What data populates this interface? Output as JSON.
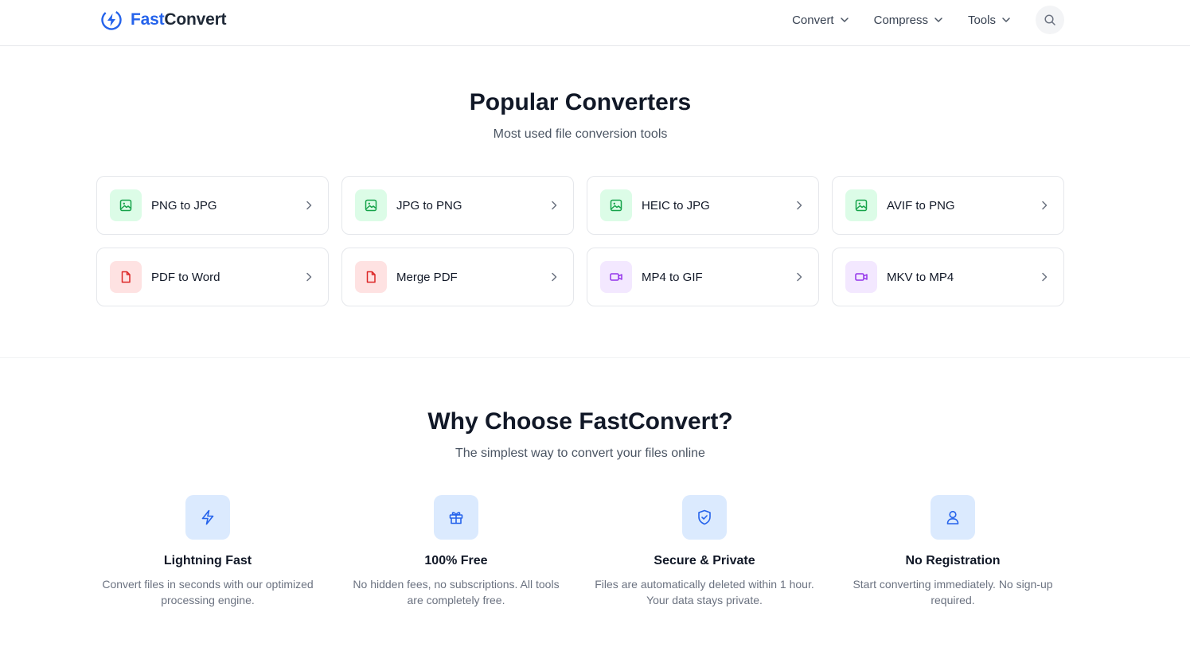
{
  "header": {
    "logo_part1": "Fast",
    "logo_part2": "Convert",
    "nav": [
      {
        "label": "Convert"
      },
      {
        "label": "Compress"
      },
      {
        "label": "Tools"
      }
    ],
    "search_icon": "search-icon"
  },
  "popular": {
    "title": "Popular Converters",
    "subtitle": "Most used file conversion tools",
    "items": [
      {
        "label": "PNG to JPG",
        "icon": "image-icon",
        "color": "#16a34a",
        "bg": "#dcfce7"
      },
      {
        "label": "JPG to PNG",
        "icon": "image-icon",
        "color": "#16a34a",
        "bg": "#dcfce7"
      },
      {
        "label": "HEIC to JPG",
        "icon": "image-icon",
        "color": "#16a34a",
        "bg": "#dcfce7"
      },
      {
        "label": "AVIF to PNG",
        "icon": "image-icon",
        "color": "#16a34a",
        "bg": "#dcfce7"
      },
      {
        "label": "PDF to Word",
        "icon": "file-icon",
        "color": "#dc2626",
        "bg": "#fee2e2"
      },
      {
        "label": "Merge PDF",
        "icon": "file-icon",
        "color": "#dc2626",
        "bg": "#fee2e2"
      },
      {
        "label": "MP4 to GIF",
        "icon": "video-icon",
        "color": "#9333ea",
        "bg": "#f3e8ff"
      },
      {
        "label": "MKV to MP4",
        "icon": "video-icon",
        "color": "#9333ea",
        "bg": "#f3e8ff"
      }
    ]
  },
  "why": {
    "title": "Why Choose FastConvert?",
    "subtitle": "The simplest way to convert your files online",
    "features": [
      {
        "title": "Lightning Fast",
        "desc": "Convert files in seconds with our optimized processing engine.",
        "icon": "lightning-icon"
      },
      {
        "title": "100% Free",
        "desc": "No hidden fees, no subscriptions. All tools are completely free.",
        "icon": "gift-icon"
      },
      {
        "title": "Secure & Private",
        "desc": "Files are automatically deleted within 1 hour. Your data stays private.",
        "icon": "shield-check-icon"
      },
      {
        "title": "No Registration",
        "desc": "Start converting immediately. No sign-up required.",
        "icon": "user-icon"
      }
    ]
  },
  "colors": {
    "brand": "#2563eb",
    "text": "#111827",
    "muted": "#6b7280",
    "border": "#e5e7eb"
  }
}
